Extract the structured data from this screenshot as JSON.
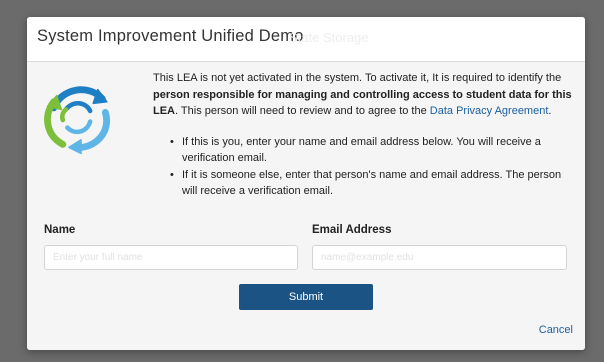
{
  "modal": {
    "title": "System Improvement Unified Demo",
    "title_ghost": "State Storage"
  },
  "intro": {
    "text_1": "This LEA is not yet activated in the system. To activate it, It is required to identify the ",
    "text_bold": "person responsible for managing and controlling access to student data for this LEA",
    "text_2": ". This person will need to review and to agree to the ",
    "link": "Data Privacy Agreement",
    "text_3": "."
  },
  "bullets": [
    "If this is you, enter your name and email address below. You will receive a verification email.",
    "If it is someone else, enter that person's name and email address. The person will receive a verification email."
  ],
  "form": {
    "name_label": "Name",
    "name_placeholder": "Enter your full name",
    "email_label": "Email Address",
    "email_placeholder": "name@example.edu",
    "submit_label": "Submit",
    "cancel_label": "Cancel"
  },
  "icons": {
    "logo": "circular-arrows-logo-icon"
  },
  "colors": {
    "accent": "#1a5384",
    "link": "#1a5f9e",
    "logo_blue": "#1f7fc4",
    "logo_light_blue": "#5fb6e6",
    "logo_green": "#7cbf3a"
  }
}
